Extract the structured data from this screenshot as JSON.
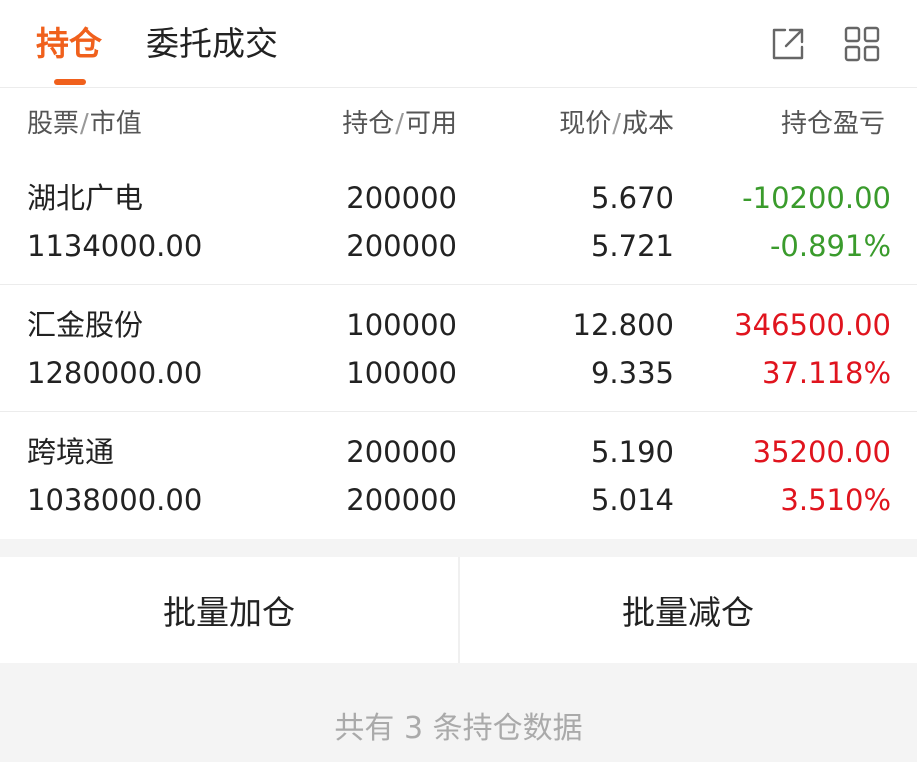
{
  "tabs": [
    {
      "label": "持仓",
      "active": true
    },
    {
      "label": "委托成交",
      "active": false
    }
  ],
  "toolbar": {
    "share_icon": "share-external-icon",
    "grid_icon": "grid-menu-icon"
  },
  "columns": {
    "col1": {
      "main": "股票",
      "sep": "/",
      "sub": "市值"
    },
    "col2": {
      "main": "持仓",
      "sep": "/",
      "sub": "可用"
    },
    "col3": {
      "main": "现价",
      "sep": "/",
      "sub": "成本"
    },
    "col4": {
      "main": "持仓盈亏"
    }
  },
  "holdings": [
    {
      "name": "湖北广电",
      "market_value": "1134000.00",
      "position": "200000",
      "available": "200000",
      "price": "5.670",
      "cost": "5.721",
      "pnl": "-10200.00",
      "pnl_pct": "-0.891%",
      "trend": "down"
    },
    {
      "name": "汇金股份",
      "market_value": "1280000.00",
      "position": "100000",
      "available": "100000",
      "price": "12.800",
      "cost": "9.335",
      "pnl": "346500.00",
      "pnl_pct": "37.118%",
      "trend": "up"
    },
    {
      "name": "跨境通",
      "market_value": "1038000.00",
      "position": "200000",
      "available": "200000",
      "price": "5.190",
      "cost": "5.014",
      "pnl": "35200.00",
      "pnl_pct": "3.510%",
      "trend": "up"
    }
  ],
  "actions": {
    "batch_add": "批量加仓",
    "batch_reduce": "批量减仓"
  },
  "footer": {
    "summary": "共有 3 条持仓数据"
  },
  "colors": {
    "accent": "#f0601c",
    "loss": "#3a9b2c",
    "gain": "#e0141e"
  }
}
